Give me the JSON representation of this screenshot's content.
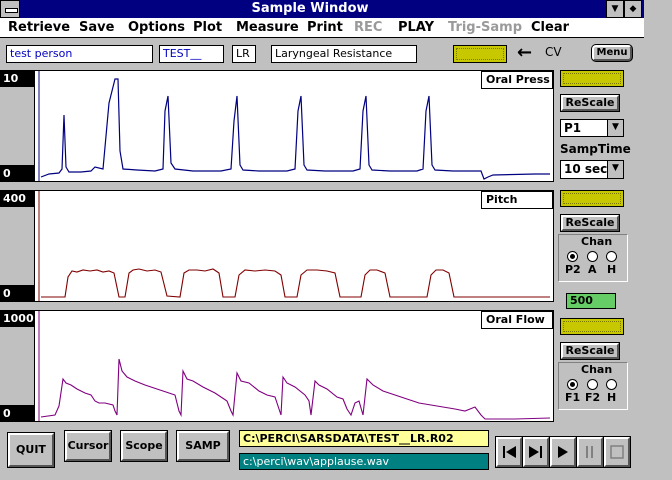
{
  "window": {
    "title": "Sample Window"
  },
  "menu": [
    "Retrieve",
    "Save",
    "Options",
    "Plot",
    "Measure",
    "Print",
    "REC",
    "PLAY",
    "Trig-Samp",
    "Clear"
  ],
  "menu_disabled": [
    "REC",
    "Trig-Samp"
  ],
  "info": {
    "subject": "test person",
    "file_id": "TEST__",
    "mode": "LR",
    "description": "Laryngeal Resistance",
    "cv_label": "CV",
    "menu_button": "Menu"
  },
  "plots": [
    {
      "name": "Oral Press",
      "scale_max": "10",
      "scale_min": "0",
      "color": "#000080"
    },
    {
      "name": "Pitch",
      "scale_max": "400",
      "scale_min": "0",
      "color": "#800000"
    },
    {
      "name": "Oral Flow",
      "scale_max": "1000",
      "scale_min": "0",
      "color": "#800080"
    }
  ],
  "controls": {
    "rescale": "ReScale",
    "p_select": "P1",
    "samptime_label": "SampTime",
    "samptime_value": "10 sec",
    "chan_label": "Chan",
    "pitch_chan": {
      "options": [
        "P2",
        "A",
        "H"
      ],
      "selected": "P2"
    },
    "flow_chan": {
      "options": [
        "F1",
        "F2",
        "H"
      ],
      "selected": "F1"
    },
    "pitch_value": "500"
  },
  "bottom": {
    "quit": "QUIT",
    "cursor": "Cursor",
    "scope": "Scope",
    "samp": "SAMP",
    "data_path": "C:\\PERCI\\SARSDATA\\TEST__LR.R02",
    "wav_path": "c:\\perci\\wav\\applause.wav"
  },
  "colors": {
    "title_bar": "#000080",
    "indicator": "#c8c800",
    "wav_field": "#008080",
    "path_field": "#ffff99",
    "pitch_value_bg": "#66cc66"
  }
}
